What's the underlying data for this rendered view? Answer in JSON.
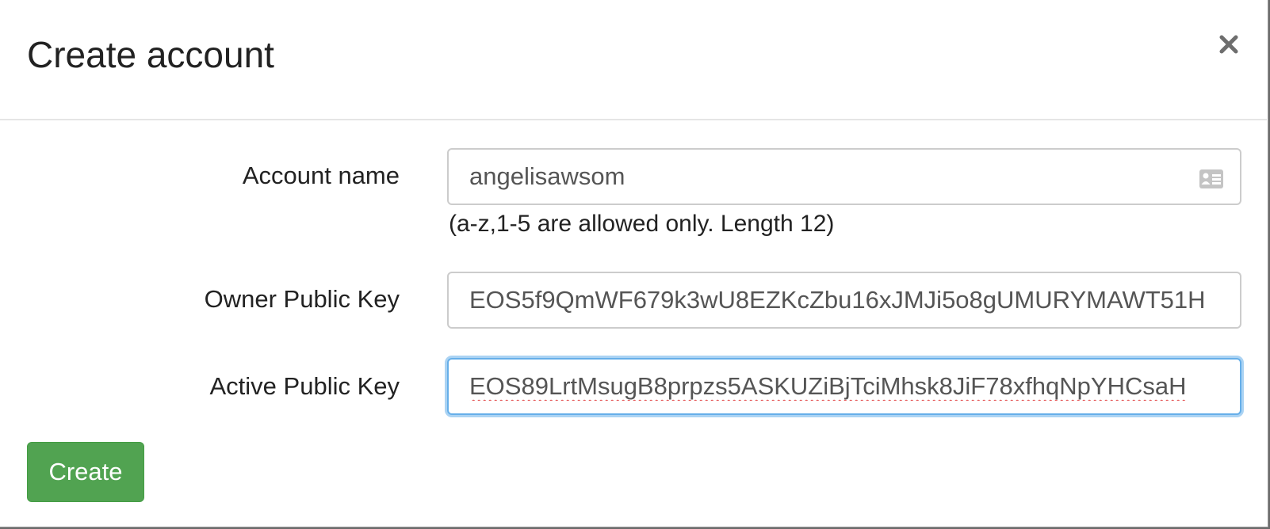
{
  "dialog": {
    "title": "Create account",
    "close_label": "×"
  },
  "form": {
    "account_name": {
      "label": "Account name",
      "value": "angelisawsom",
      "help": "(a-z,1-5 are allowed only. Length 12)",
      "icon": "contact-card-icon"
    },
    "owner_key": {
      "label": "Owner Public Key",
      "value": "EOS5f9QmWF679k3wU8EZKcZbu16xJMJi5o8gUMURYMAWT51H"
    },
    "active_key": {
      "label": "Active Public Key",
      "value": "EOS89LrtMsugB8prpzs5ASKUZiBjTciMhsk8JiF78xfhqNpYHCsaH"
    }
  },
  "actions": {
    "create_label": "Create"
  },
  "colors": {
    "primary_button": "#51a351",
    "focus_border": "#66afe9"
  }
}
